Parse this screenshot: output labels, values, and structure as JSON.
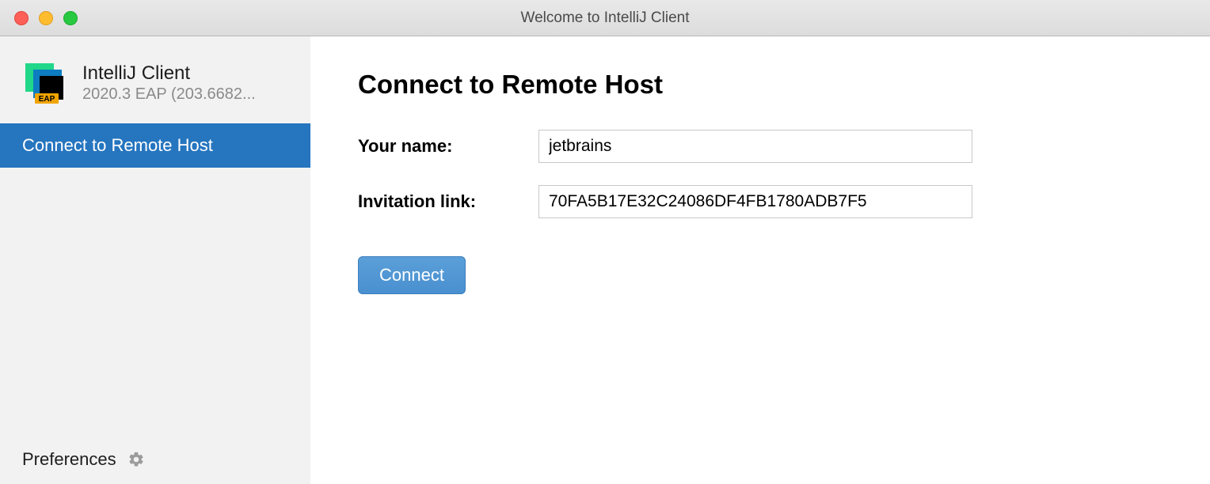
{
  "window": {
    "title": "Welcome to IntelliJ Client"
  },
  "sidebar": {
    "app_name": "IntelliJ Client",
    "app_version": "2020.3 EAP (203.6682...",
    "items": [
      {
        "label": "Connect to Remote Host",
        "selected": true
      }
    ],
    "footer": {
      "preferences": "Preferences"
    }
  },
  "main": {
    "heading": "Connect to Remote Host",
    "name_label": "Your name:",
    "name_value": "jetbrains",
    "link_label": "Invitation link:",
    "link_value": "70FA5B17E32C24086DF4FB1780ADB7F5",
    "connect_label": "Connect"
  }
}
